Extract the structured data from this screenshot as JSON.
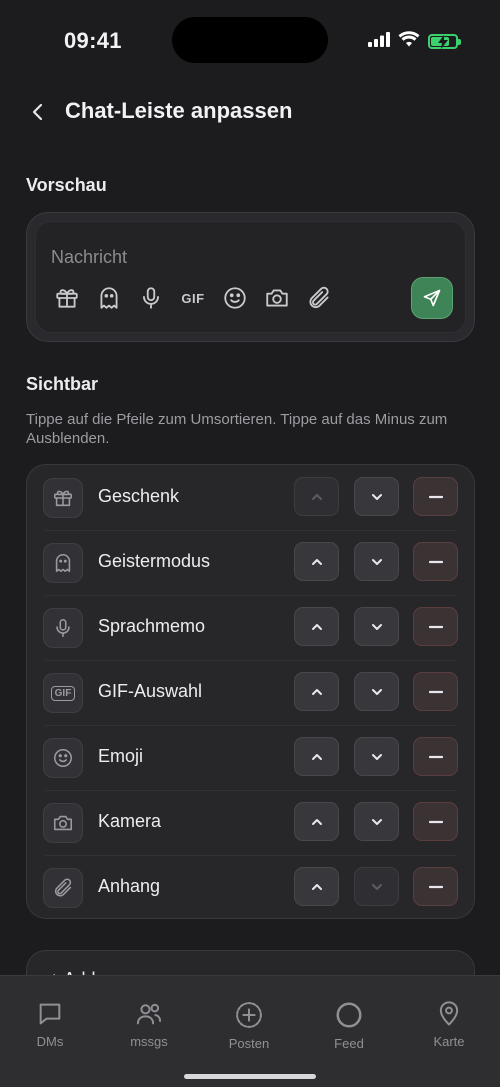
{
  "status_bar": {
    "time": "09:41"
  },
  "header": {
    "title": "Chat-Leiste anpassen"
  },
  "preview": {
    "section_label": "Vorschau",
    "placeholder": "Nachricht",
    "gif_label": "GIF",
    "icons": [
      "gift-icon",
      "ghost-icon",
      "mic-icon",
      "gif-icon",
      "emoji-icon",
      "camera-icon",
      "paperclip-icon",
      "send-icon"
    ]
  },
  "visible": {
    "section_label": "Sichtbar",
    "hint": "Tippe auf die Pfeile zum Umsortieren. Tippe auf das Minus zum Ausblenden.",
    "items": [
      {
        "label": "Geschenk",
        "icon": "gift-icon"
      },
      {
        "label": "Geistermodus",
        "icon": "ghost-icon"
      },
      {
        "label": "Sprachmemo",
        "icon": "mic-icon"
      },
      {
        "label": "GIF-Auswahl",
        "icon": "gif-icon",
        "icon_text": "GIF"
      },
      {
        "label": "Emoji",
        "icon": "emoji-icon"
      },
      {
        "label": "Kamera",
        "icon": "camera-icon"
      },
      {
        "label": "Anhang",
        "icon": "paperclip-icon"
      }
    ]
  },
  "hidden_card": {
    "label": "+ Add"
  },
  "tabbar": {
    "tabs": [
      {
        "label": "DMs",
        "icon": "message-icon"
      },
      {
        "label": "mssgs",
        "icon": "users-icon"
      },
      {
        "label": "Posten",
        "icon": "plus-circle-icon"
      },
      {
        "label": "Feed",
        "icon": "circle-icon"
      },
      {
        "label": "Karte",
        "icon": "map-pin-icon"
      }
    ]
  },
  "colors": {
    "background": "#1c1c1e",
    "send_button": "#3f8456",
    "battery": "#3bd16f",
    "minus_border": "#5a3e40"
  }
}
